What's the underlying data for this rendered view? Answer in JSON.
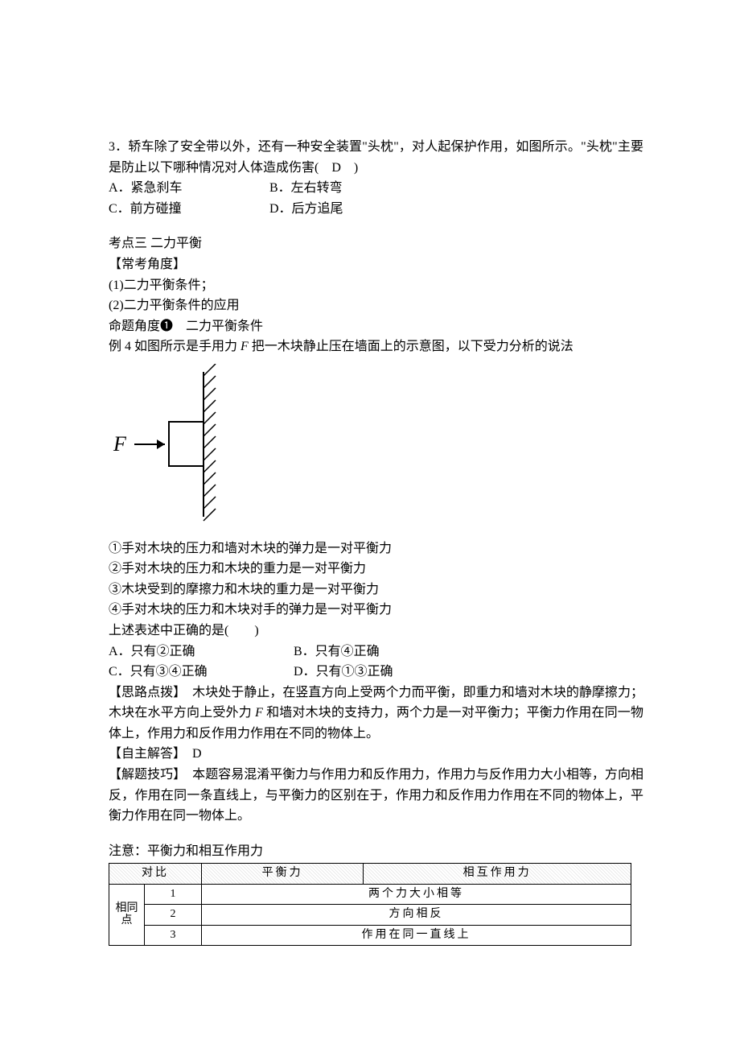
{
  "q3": {
    "stem": "3．轿车除了安全带以外，还有一种安全装置\"头枕\"，对人起保护作用，如图所示。\"头枕\"主要是防止以下哪种情况对人体造成伤害(　D　)",
    "optA": "A．紧急刹车",
    "optB": "B．左右转弯",
    "optC": "C．前方碰撞",
    "optD": "D．后方追尾"
  },
  "section3": {
    "title": "考点三 二力平衡",
    "heading": "【常考角度】",
    "pt1": "(1)二力平衡条件；",
    "pt2": "(2)二力平衡条件的应用",
    "angle": "命题角度❶　二力平衡条件"
  },
  "q4": {
    "stem_pre": "例 4 如图所示是手用力 ",
    "stem_F": "F",
    "stem_post": " 把一木块静止压在墙面上的示意图，以下受力分析的说法",
    "s1": "①手对木块的压力和墙对木块的弹力是一对平衡力",
    "s2": "②手对木块的压力和木块的重力是一对平衡力",
    "s3": "③木块受到的摩擦力和木块的重力是一对平衡力",
    "s4": "④手对木块的压力和木块对手的弹力是一对平衡力",
    "ask": "上述表述中正确的是(　　)",
    "optA": "A．只有②正确",
    "optB": "B．只有④正确",
    "optC": "C．只有③④正确",
    "optD": "D．只有①③正确"
  },
  "explain": {
    "h1": "【思路点拨】　",
    "t1a": "木块处于静止，在竖直方向上受两个力而平衡，即重力和墙对木块的静摩擦力；木块在水平方向上受外力 ",
    "t1F": "F",
    "t1b": " 和墙对木块的支持力，两个力是一对平衡力；平衡力作用在同一物体上，作用力和反作用力作用在不同的物体上。",
    "h2": "【自主解答】　D",
    "h3": "【解题技巧】　",
    "t3": "本题容易混淆平衡力与作用力和反作用力，作用力与反作用力大小相等，方向相反，作用在同一条直线上，与平衡力的区别在于，作用力和反作用力作用在不同的物体上，平衡力作用在同一物体上。"
  },
  "note": "注意：平衡力和相互作用力",
  "table": {
    "head1": "对比",
    "head2": "平衡力",
    "head3": "相互作用力",
    "group": "相同点",
    "n1": "1",
    "n2": "2",
    "n3": "3",
    "r1": "两个力大小相等",
    "r2": "方向相反",
    "r3": "作用在同一直线上"
  },
  "fig_label": "F"
}
